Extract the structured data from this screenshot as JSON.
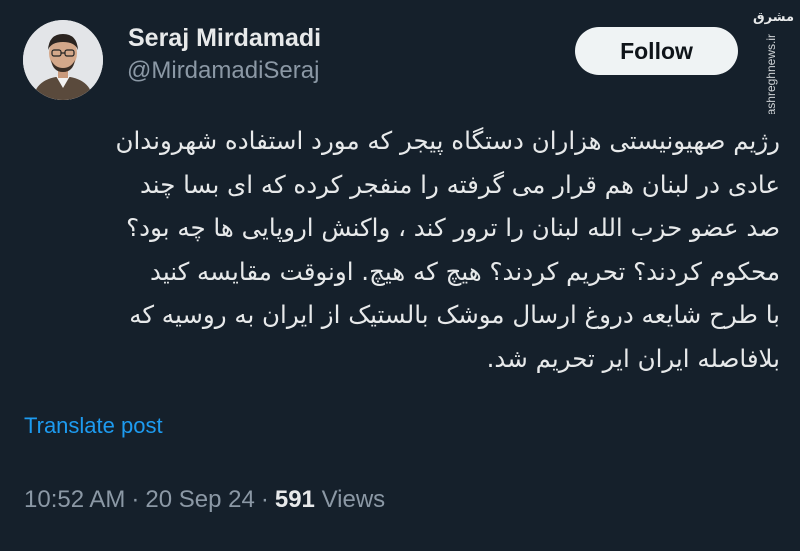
{
  "author": {
    "name": "Seraj Mirdamadi",
    "handle": "@MirdamadiSeraj"
  },
  "follow_button": {
    "label": "Follow"
  },
  "watermark": {
    "logo_text": "مشرق",
    "url": "mashreghnews.ir"
  },
  "tweet": {
    "lines": [
      "رژیم صهیونیستی هزاران دستگاه پیجر که مورد استفاده شهروندان",
      "عادی در لبنان هم قرار می گرفته را منفجر کرده که ای بسا چند",
      "صد عضو حزب الله لبنان را ترور کند ، واکنش اروپایی ها چه بود؟",
      "محکوم کردند؟ تحریم کردند؟ هیچ که هیچ. اونوقت مقایسه کنید",
      "با طرح شایعه دروغ ارسال موشک بالستیک از ایران به روسیه که",
      "بلافاصله ایران ایر تحریم شد."
    ]
  },
  "translate_link": {
    "label": "Translate post"
  },
  "meta": {
    "time": "10:52 AM",
    "date": "20 Sep 24",
    "views_count": "591",
    "views_label": "Views",
    "separator": "·"
  },
  "colors": {
    "background": "#15202b",
    "primary_text": "#e7e9ea",
    "secondary_text": "#8b98a5",
    "link": "#1d9bf0",
    "button_bg": "#eff3f4"
  }
}
